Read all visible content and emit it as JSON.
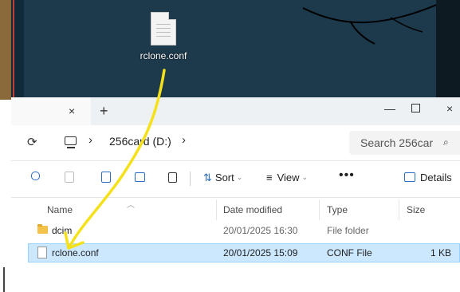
{
  "desktop": {
    "icon_label": "rclone.conf",
    "icon_name": "file-icon"
  },
  "explorer": {
    "tab": {
      "close_icon": "×",
      "new_tab_icon": "+"
    },
    "window_controls": {
      "minimize": "—",
      "close": "×"
    },
    "address": {
      "refresh_icon": "⟳",
      "chevron": "›",
      "breadcrumb": "256card (D:)"
    },
    "search": {
      "placeholder": "Search 256car",
      "icon": "⌕"
    },
    "toolbar": {
      "sort_label": "Sort",
      "view_label": "View",
      "more_label": "•••",
      "details_label": "Details"
    },
    "columns": {
      "name": "Name",
      "date_modified": "Date modified",
      "type": "Type",
      "size": "Size"
    },
    "rows": [
      {
        "name": "dcim",
        "date": "20/01/2025 16:30",
        "type": "File folder",
        "size": "",
        "icon": "folder-icon",
        "selected": false
      },
      {
        "name": "rclone.conf",
        "date": "20/01/2025 15:09",
        "type": "CONF File",
        "size": "1 KB",
        "icon": "conf-file-icon",
        "selected": true
      }
    ]
  },
  "annotation": {
    "arrow_color": "#f5e11a"
  }
}
